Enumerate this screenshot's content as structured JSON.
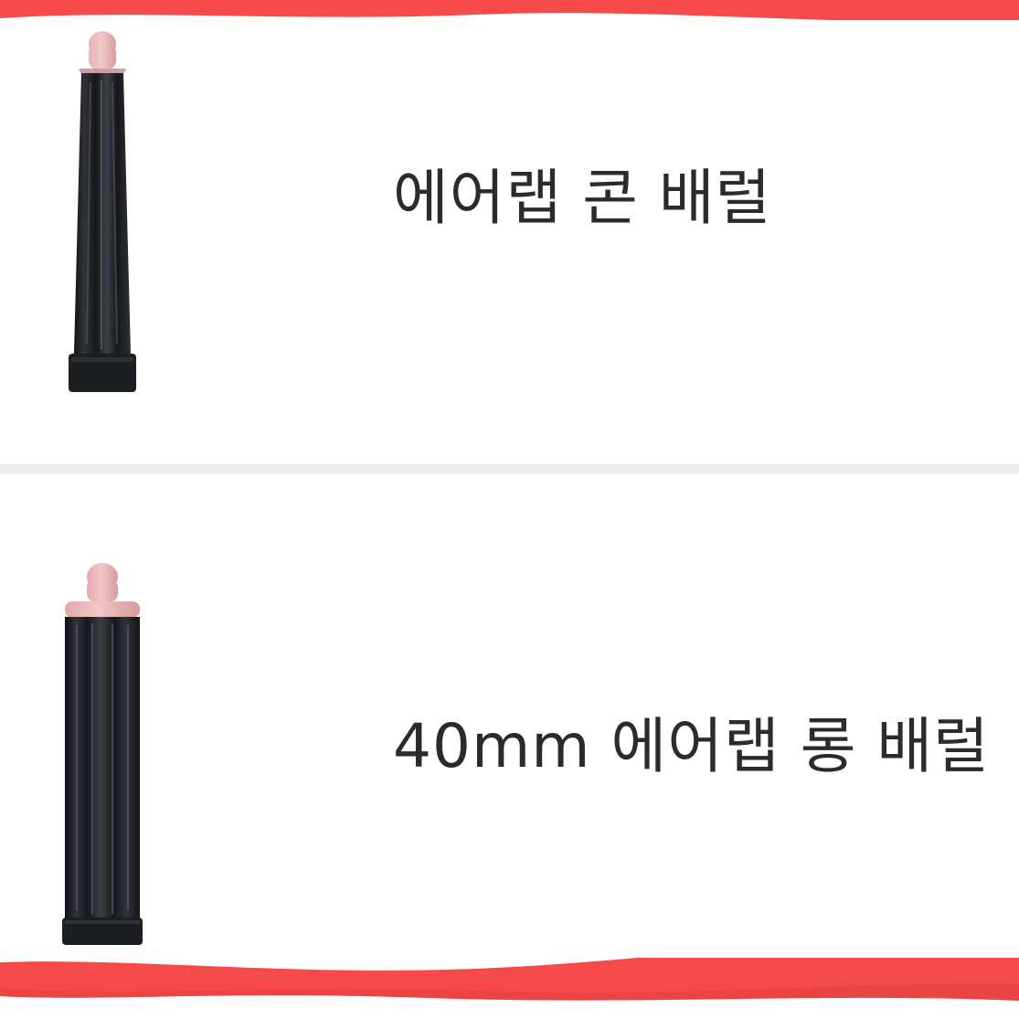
{
  "colors": {
    "background": "#ffffff",
    "ribbon": "#f44a4a",
    "barrel": "#1f2227",
    "cap": "#efbfc0",
    "divider": "#ececec",
    "text": "#2b2b2b"
  },
  "items": [
    {
      "label": "에어랩 콘 배럴",
      "image": "cone-barrel-icon"
    },
    {
      "label": "40mm 에어랩 롱 배럴",
      "image": "long-barrel-icon"
    }
  ]
}
